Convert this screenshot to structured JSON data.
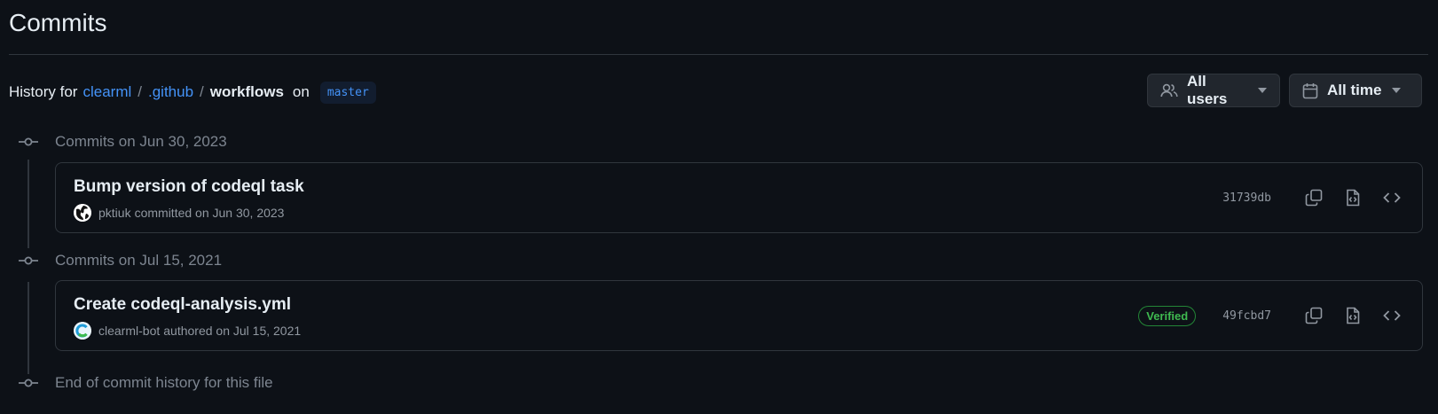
{
  "page": {
    "title": "Commits"
  },
  "history": {
    "prefix": "History for",
    "repo": "clearml",
    "sep1": "/",
    "folder": ".github",
    "sep2": "/",
    "current": "workflows",
    "on": "on",
    "branch": "master"
  },
  "filters": {
    "users": {
      "label": "All users",
      "icon": "people-icon"
    },
    "time": {
      "label": "All time",
      "icon": "calendar-icon"
    }
  },
  "groups": [
    {
      "heading": "Commits on Jun 30, 2023",
      "commit": {
        "title": "Bump version of codeql task",
        "author": "pktiuk",
        "action": "committed on Jun 30, 2023",
        "verified": false,
        "sha": "31739db"
      }
    },
    {
      "heading": "Commits on Jul 15, 2021",
      "commit": {
        "title": "Create codeql-analysis.yml",
        "author": "clearml-bot",
        "action": "authored on Jul 15, 2021",
        "verified": true,
        "verified_label": "Verified",
        "sha": "49fcbd7"
      }
    }
  ],
  "end_text": "End of commit history for this file",
  "colors": {
    "background": "#0d1117",
    "link": "#4493f8",
    "muted": "#7d8590",
    "verified": "#3fb950",
    "border": "#30363d"
  }
}
